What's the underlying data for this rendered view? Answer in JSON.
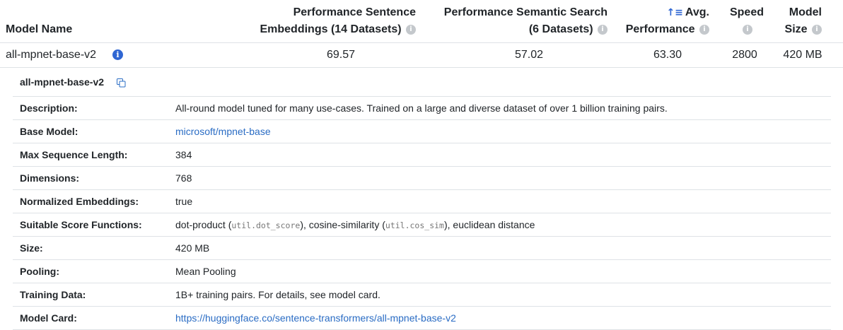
{
  "header": {
    "model_name": "Model Name",
    "perf_sent_line1": "Performance Sentence",
    "perf_sent_line2": "Embeddings (14 Datasets)",
    "perf_search_line1": "Performance Semantic Search",
    "perf_search_line2": "(6 Datasets)",
    "avg_line1": "Avg.",
    "avg_line2": "Performance",
    "speed": "Speed",
    "size_line1": "Model",
    "size_line2": "Size"
  },
  "model_row": {
    "name": "all-mpnet-base-v2",
    "perf_sent": "69.57",
    "perf_search": "57.02",
    "avg": "63.30",
    "speed": "2800",
    "size": "420 MB"
  },
  "detail": {
    "title": "all-mpnet-base-v2",
    "rows": [
      {
        "label": "Description:",
        "value": "All-round model tuned for many use-cases. Trained on a large and diverse dataset of over 1 billion training pairs."
      },
      {
        "label": "Base Model:",
        "value": "microsoft/mpnet-base"
      },
      {
        "label": "Max Sequence Length:",
        "value": "384"
      },
      {
        "label": "Dimensions:",
        "value": "768"
      },
      {
        "label": "Normalized Embeddings:",
        "value": "true"
      },
      {
        "label": "Suitable Score Functions:",
        "value_parts": [
          "dot-product (",
          "util.dot_score",
          "), cosine-similarity (",
          "util.cos_sim",
          "), euclidean distance"
        ]
      },
      {
        "label": "Size:",
        "value": "420 MB"
      },
      {
        "label": "Pooling:",
        "value": "Mean Pooling"
      },
      {
        "label": "Training Data:",
        "value": "1B+ training pairs. For details, see model card."
      },
      {
        "label": "Model Card:",
        "value": "https://huggingface.co/sentence-transformers/all-mpnet-base-v2"
      }
    ]
  },
  "icons": {
    "info": "i",
    "sort": "↑≡"
  },
  "colors": {
    "link": "#2a6cc4",
    "accent": "#2f66d3",
    "muted_icon": "#c4c8cc",
    "border": "#dee2e6"
  }
}
